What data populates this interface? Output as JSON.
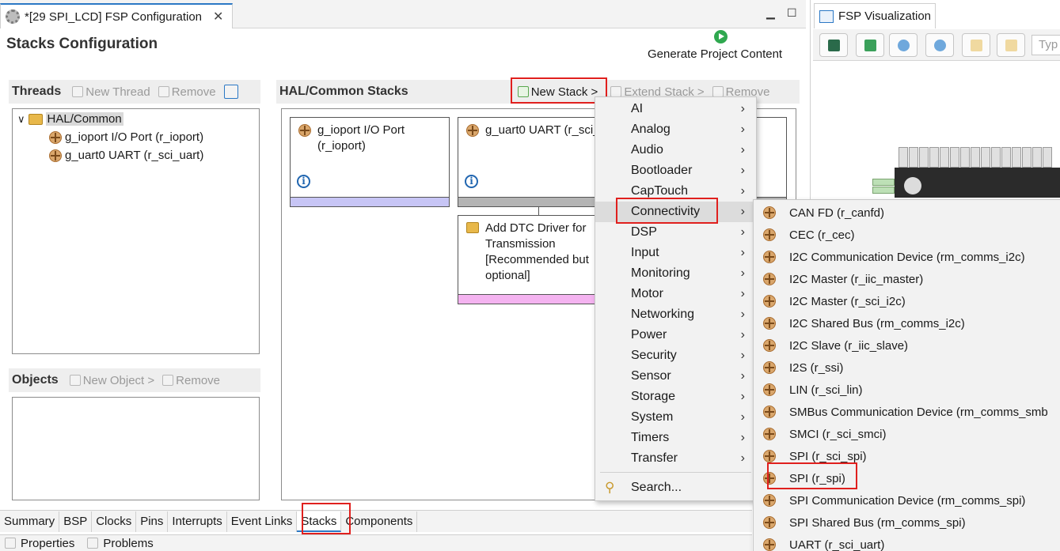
{
  "editor_tab": {
    "title": "*[29 SPI_LCD] FSP Configuration"
  },
  "page_title": "Stacks Configuration",
  "generate": {
    "label": "Generate Project Content"
  },
  "threads": {
    "header": "Threads",
    "new_thread": "New Thread",
    "remove": "Remove",
    "tree": {
      "root": "HAL/Common",
      "children": [
        "g_ioport I/O Port (r_ioport)",
        "g_uart0 UART (r_sci_uart)"
      ]
    }
  },
  "objects": {
    "header": "Objects",
    "new_object": "New Object >",
    "remove": "Remove"
  },
  "stacks": {
    "header": "HAL/Common Stacks",
    "new_stack": "New Stack >",
    "extend_stack": "Extend Stack >",
    "remove": "Remove",
    "boxes": [
      {
        "line1": "g_ioport I/O Port",
        "line2": "(r_ioport)",
        "bar_color": "#c7c5f5"
      },
      {
        "line1": "g_uart0 UART (r_sci_uart)",
        "bar_color": "#b4b4b4"
      },
      {
        "line1": "Add DTC Driver for",
        "line2": "Transmission",
        "line3": "[Recommended but",
        "line4": "optional]",
        "bar_color": "#f4b3f0"
      }
    ]
  },
  "menu": {
    "items": [
      "AI",
      "Analog",
      "Audio",
      "Bootloader",
      "CapTouch",
      "Connectivity",
      "DSP",
      "Input",
      "Monitoring",
      "Motor",
      "Networking",
      "Power",
      "Security",
      "Sensor",
      "Storage",
      "System",
      "Timers",
      "Transfer"
    ],
    "search": "Search...",
    "highlighted": "Connectivity"
  },
  "submenu": {
    "items": [
      "CAN FD (r_canfd)",
      "CEC (r_cec)",
      "I2C Communication Device (rm_comms_i2c)",
      "I2C Master (r_iic_master)",
      "I2C Master (r_sci_i2c)",
      "I2C Shared Bus (rm_comms_i2c)",
      "I2C Slave (r_iic_slave)",
      "I2S (r_ssi)",
      "LIN (r_sci_lin)",
      "SMBus Communication Device (rm_comms_smb",
      "SMCI (r_sci_smci)",
      "SPI (r_sci_spi)",
      "SPI (r_spi)",
      "SPI Communication Device (rm_comms_spi)",
      "SPI Shared Bus (rm_comms_spi)",
      "UART (r_sci_uart)"
    ],
    "selected": "SPI (r_spi)"
  },
  "bottom_tabs": [
    "Summary",
    "BSP",
    "Clocks",
    "Pins",
    "Interrupts",
    "Event Links",
    "Stacks",
    "Components"
  ],
  "active_bottom_tab": "Stacks",
  "bottom_views": {
    "properties": "Properties",
    "problems": "Problems"
  },
  "visualization": {
    "tab_title": "FSP Visualization",
    "search_placeholder": "Typ"
  },
  "colors": {
    "accent": "#2b78c5",
    "highlight_border": "#e0201e",
    "menu_bg": "#f2f2f2"
  }
}
